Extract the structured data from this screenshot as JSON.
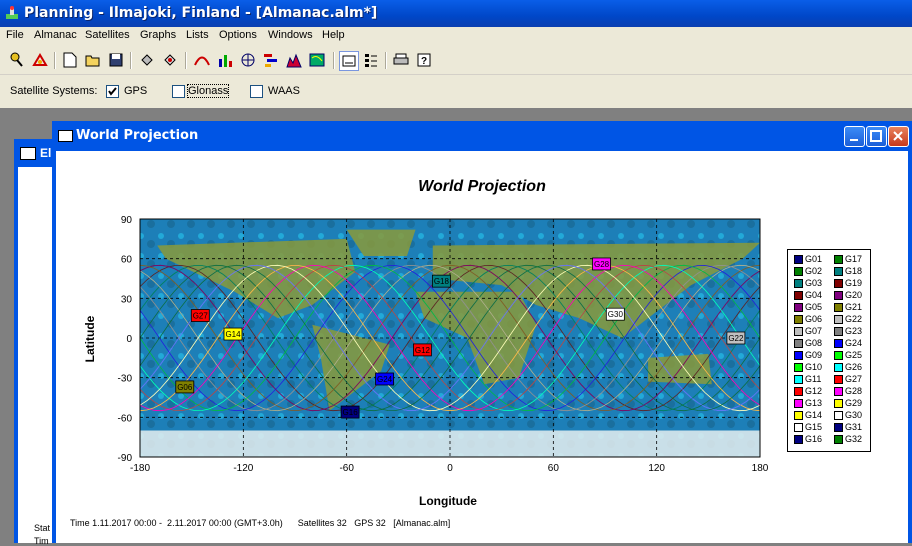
{
  "window_title": "Planning - Ilmajoki, Finland - [Almanac.alm*]",
  "menu": [
    "File",
    "Almanac",
    "Satellites",
    "Graphs",
    "Lists",
    "Options",
    "Windows",
    "Help"
  ],
  "systems": {
    "label": "Satellite Systems:",
    "items": [
      {
        "name": "GPS",
        "checked": true
      },
      {
        "name": "Glonass",
        "checked": false
      },
      {
        "name": "WAAS",
        "checked": false
      }
    ]
  },
  "background_window": {
    "title_fragment": "El",
    "status_fragment": "Stat",
    "time_fragment": "Tim"
  },
  "child_window": {
    "title": "World Projection",
    "chart_title": "World Projection",
    "status": "Time 1.11.2017 00:00 -  2.11.2017 00:00 (GMT+3.0h)      Satellites 32   GPS 32   [Almanac.alm]"
  },
  "colors": {
    "title_blue": "#0054e3",
    "menu_bg": "#ece9d8",
    "mdi_bg": "#808080"
  },
  "chart_data": {
    "type": "scatter",
    "title": "World Projection",
    "xlabel": "Longitude",
    "ylabel": "Latitude",
    "xlim": [
      -180,
      180
    ],
    "ylim": [
      -90,
      90
    ],
    "xticks": [
      -180,
      -120,
      -60,
      0,
      60,
      120,
      180
    ],
    "yticks": [
      90,
      60,
      30,
      0,
      -30,
      -60,
      -90
    ],
    "grid": true,
    "legend_position": "right",
    "series": [
      {
        "name": "G01",
        "color": "#000080"
      },
      {
        "name": "G02",
        "color": "#008000"
      },
      {
        "name": "G03",
        "color": "#008080"
      },
      {
        "name": "G04",
        "color": "#800000"
      },
      {
        "name": "G05",
        "color": "#800080"
      },
      {
        "name": "G06",
        "color": "#808000"
      },
      {
        "name": "G07",
        "color": "#c0c0c0"
      },
      {
        "name": "G08",
        "color": "#808080"
      },
      {
        "name": "G09",
        "color": "#0000ff"
      },
      {
        "name": "G10",
        "color": "#00ff00"
      },
      {
        "name": "G11",
        "color": "#00ffff"
      },
      {
        "name": "G12",
        "color": "#ff0000"
      },
      {
        "name": "G13",
        "color": "#ff00ff"
      },
      {
        "name": "G14",
        "color": "#ffff00"
      },
      {
        "name": "G15",
        "color": "#ffffff"
      },
      {
        "name": "G16",
        "color": "#000080"
      },
      {
        "name": "G17",
        "color": "#008000"
      },
      {
        "name": "G18",
        "color": "#008080"
      },
      {
        "name": "G19",
        "color": "#800000"
      },
      {
        "name": "G20",
        "color": "#800080"
      },
      {
        "name": "G21",
        "color": "#808000"
      },
      {
        "name": "G22",
        "color": "#c0c0c0"
      },
      {
        "name": "G23",
        "color": "#808080"
      },
      {
        "name": "G24",
        "color": "#0000ff"
      },
      {
        "name": "G25",
        "color": "#00ff00"
      },
      {
        "name": "G26",
        "color": "#00ffff"
      },
      {
        "name": "G27",
        "color": "#ff0000"
      },
      {
        "name": "G28",
        "color": "#ff00ff"
      },
      {
        "name": "G29",
        "color": "#ffff00"
      },
      {
        "name": "G30",
        "color": "#ffffff"
      },
      {
        "name": "G31",
        "color": "#000080"
      },
      {
        "name": "G32",
        "color": "#008000"
      }
    ],
    "satellite_labels": [
      {
        "name": "G16",
        "lon": -58,
        "lat": -56
      },
      {
        "name": "G14",
        "lon": -126,
        "lat": 3
      },
      {
        "name": "G12",
        "lon": -16,
        "lat": -9
      },
      {
        "name": "G30",
        "lon": 96,
        "lat": 18
      },
      {
        "name": "G22",
        "lon": 166,
        "lat": 0
      },
      {
        "name": "G28",
        "lon": 88,
        "lat": 56
      },
      {
        "name": "G18",
        "lon": -5,
        "lat": 43
      },
      {
        "name": "G24",
        "lon": -38,
        "lat": -31
      },
      {
        "name": "G06",
        "lon": -154,
        "lat": -37
      },
      {
        "name": "G27",
        "lon": -145,
        "lat": 17
      }
    ]
  }
}
